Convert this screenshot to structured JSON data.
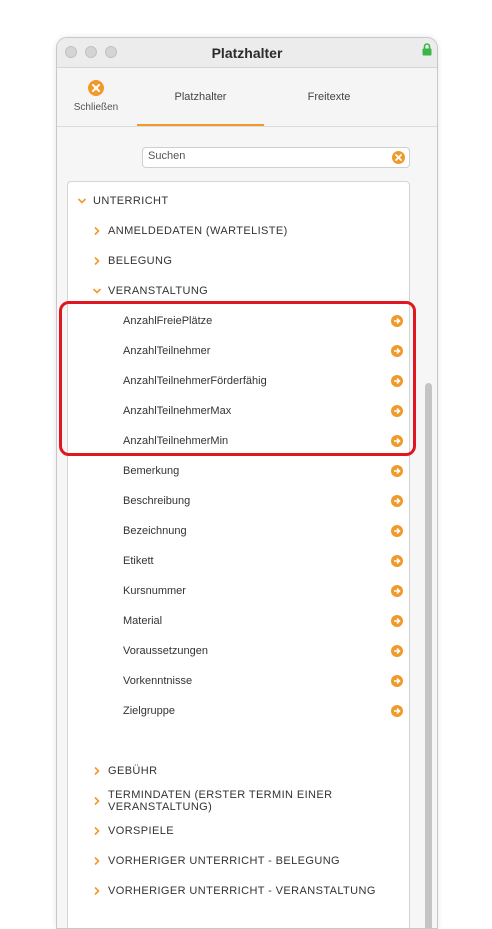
{
  "window": {
    "title": "Platzhalter"
  },
  "toolbar": {
    "close_label": "Schließen",
    "tabs": [
      {
        "label": "Platzhalter"
      },
      {
        "label": "Freitexte"
      }
    ]
  },
  "search": {
    "value": "Suchen"
  },
  "tree": {
    "root": "UNTERRICHT",
    "groups_top": [
      {
        "label": "ANMELDEDATEN (WARTELISTE)"
      },
      {
        "label": "BELEGUNG"
      },
      {
        "label": "VERANSTALTUNG"
      }
    ],
    "leaves": [
      "AnzahlFreiePlätze",
      "AnzahlTeilnehmer",
      "AnzahlTeilnehmerFörderfähig",
      "AnzahlTeilnehmerMax",
      "AnzahlTeilnehmerMin",
      "Bemerkung",
      "Beschreibung",
      "Bezeichnung",
      "Etikett",
      "Kursnummer",
      "Material",
      "Voraussetzungen",
      "Vorkenntnisse",
      "Zielgruppe"
    ],
    "groups_bottom": [
      {
        "label": "GEBÜHR"
      },
      {
        "label_line1": "TERMINDATEN (ERSTER TERMIN EINER",
        "label_line2": "VERANSTALTUNG)"
      },
      {
        "label": "VORSPIELE"
      },
      {
        "label": "VORHERIGER UNTERRICHT - BELEGUNG"
      },
      {
        "label": "VORHERIGER UNTERRICHT - VERANSTALTUNG"
      }
    ]
  },
  "colors": {
    "accent": "#ef9a2b",
    "highlight": "#e0171e",
    "lock": "#3bb54a"
  }
}
